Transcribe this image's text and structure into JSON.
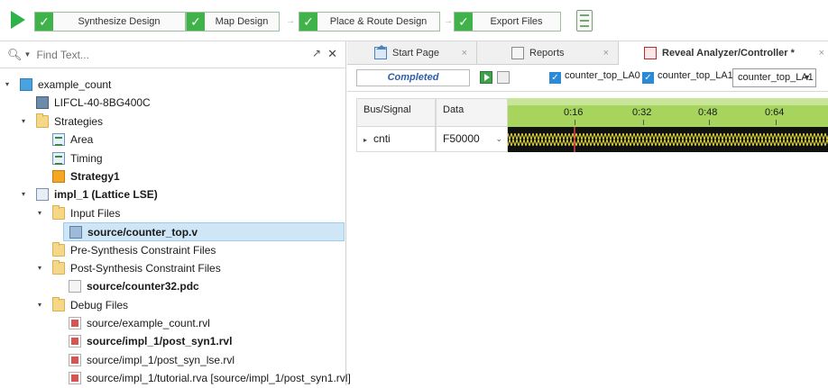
{
  "flow": {
    "steps": [
      {
        "label": "Synthesize Design",
        "done": true
      },
      {
        "label": "Map Design",
        "done": true
      },
      {
        "label": "Place & Route Design",
        "done": true
      },
      {
        "label": "Export Files",
        "done": true
      }
    ],
    "check_glyph": "✓",
    "arrow_glyph": "→"
  },
  "left": {
    "search": {
      "placeholder": "Find Text...",
      "value": ""
    },
    "tree": [
      {
        "label": "example_count",
        "icon": "project-icon",
        "indent": 0,
        "twisty": "expanded",
        "bold": false
      },
      {
        "label": "LIFCL-40-8BG400C",
        "icon": "device-chip-icon",
        "indent": 1,
        "twisty": "none",
        "bold": false
      },
      {
        "label": "Strategies",
        "icon": "folder-icon",
        "indent": 1,
        "twisty": "expanded",
        "bold": false
      },
      {
        "label": "Area",
        "icon": "strategy-icon",
        "indent": 2,
        "twisty": "none",
        "bold": false
      },
      {
        "label": "Timing",
        "icon": "strategy-icon",
        "indent": 2,
        "twisty": "none",
        "bold": false
      },
      {
        "label": "Strategy1",
        "icon": "active-strategy-icon",
        "indent": 2,
        "twisty": "none",
        "bold": true
      },
      {
        "label": "impl_1 (Lattice LSE)",
        "icon": "implementation-icon",
        "indent": 1,
        "twisty": "expanded",
        "bold": true
      },
      {
        "label": "Input Files",
        "icon": "folder-icon",
        "indent": 2,
        "twisty": "expanded",
        "bold": false
      },
      {
        "label": "source/counter_top.v",
        "icon": "verilog-file-icon",
        "indent": 3,
        "twisty": "none",
        "bold": true,
        "selected": true
      },
      {
        "label": "Pre-Synthesis Constraint Files",
        "icon": "folder-icon",
        "indent": 2,
        "twisty": "none",
        "bold": false
      },
      {
        "label": "Post-Synthesis Constraint Files",
        "icon": "folder-icon",
        "indent": 2,
        "twisty": "expanded",
        "bold": false
      },
      {
        "label": "source/counter32.pdc",
        "icon": "pdc-file-icon",
        "indent": 3,
        "twisty": "none",
        "bold": true
      },
      {
        "label": "Debug Files",
        "icon": "folder-icon",
        "indent": 2,
        "twisty": "expanded",
        "bold": false
      },
      {
        "label": "source/example_count.rvl",
        "icon": "rvl-file-icon",
        "indent": 3,
        "twisty": "none",
        "bold": false
      },
      {
        "label": "source/impl_1/post_syn1.rvl",
        "icon": "rvl-file-icon",
        "indent": 3,
        "twisty": "none",
        "bold": true
      },
      {
        "label": "source/impl_1/post_syn_lse.rvl",
        "icon": "rvl-file-icon",
        "indent": 3,
        "twisty": "none",
        "bold": false
      },
      {
        "label": "source/impl_1/tutorial.rva [source/impl_1/post_syn1.rvl]",
        "icon": "rva-file-icon",
        "indent": 3,
        "twisty": "none",
        "bold": false
      }
    ]
  },
  "tabs": [
    {
      "label": "Start Page",
      "icon": "home-icon",
      "active": false
    },
    {
      "label": "Reports",
      "icon": "report-icon",
      "active": false
    },
    {
      "label": "Reveal Analyzer/Controller *",
      "icon": "reveal-icon",
      "active": true
    }
  ],
  "tab_close": "×",
  "controller": {
    "status": "Completed",
    "checkboxes": [
      {
        "label": "counter_top_LA0",
        "checked": true
      },
      {
        "label": "counter_top_LA1",
        "checked": true
      }
    ],
    "selected_core": "counter_top_LA1"
  },
  "waveform": {
    "columns": [
      "Bus/Signal",
      "Data"
    ],
    "ticks": [
      "0:16",
      "0:32",
      "0:48",
      "0:64"
    ],
    "signals": [
      {
        "name": "cnti",
        "data": "F50000"
      }
    ]
  }
}
